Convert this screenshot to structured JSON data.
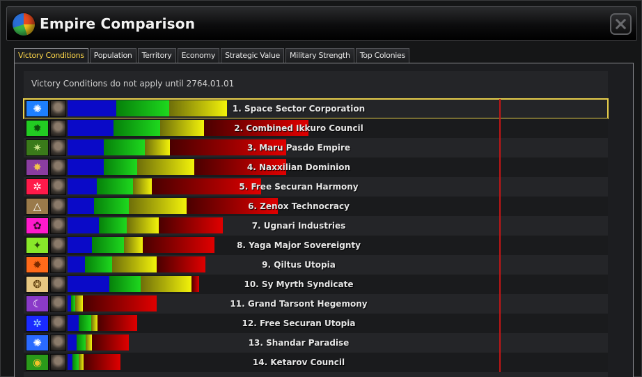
{
  "window": {
    "title": "Empire Comparison"
  },
  "tabs": [
    {
      "label": "Victory Conditions",
      "active": true
    },
    {
      "label": "Population",
      "active": false
    },
    {
      "label": "Territory",
      "active": false
    },
    {
      "label": "Economy",
      "active": false
    },
    {
      "label": "Strategic Value",
      "active": false
    },
    {
      "label": "Military Strength",
      "active": false
    },
    {
      "label": "Top Colonies",
      "active": false
    }
  ],
  "victory": {
    "note": "Victory Conditions do not apply until 2764.01.01",
    "empires": [
      {
        "name": "1. Space Sector Corporation",
        "flag_color": "#1e7fff",
        "flag_glyph": "✺",
        "flag_glyph_color": "#ffffff",
        "segments": [
          70,
          76,
          83,
          0
        ],
        "selected": true
      },
      {
        "name": "2. Combined Ikkuro Council",
        "flag_color": "#22cc22",
        "flag_glyph": "✹",
        "flag_glyph_color": "#0b4d0b",
        "segments": [
          66,
          67,
          63,
          150
        ]
      },
      {
        "name": "3. Maru Pasdo Empire",
        "flag_color": "#3a7a1a",
        "flag_glyph": "✷",
        "flag_glyph_color": "#c9e28a",
        "segments": [
          52,
          59,
          36,
          167
        ]
      },
      {
        "name": "4. Naxxilian Dominion",
        "flag_color": "#8a3da0",
        "flag_glyph": "✸",
        "flag_glyph_color": "#f2c54a",
        "segments": [
          52,
          48,
          82,
          132
        ]
      },
      {
        "name": "5. Free Securan Harmony",
        "flag_color": "#ff1a4a",
        "flag_glyph": "✲",
        "flag_glyph_color": "#ffffff",
        "segments": [
          42,
          52,
          27,
          157
        ]
      },
      {
        "name": "6. Zenox Technocracy",
        "flag_color": "#9a7a4a",
        "flag_glyph": "△",
        "flag_glyph_color": "#ffffff",
        "segments": [
          38,
          50,
          83,
          131
        ]
      },
      {
        "name": "7. Ugnari Industries",
        "flag_color": "#ff1acc",
        "flag_glyph": "✿",
        "flag_glyph_color": "#3a0a2a",
        "segments": [
          45,
          40,
          46,
          92
        ]
      },
      {
        "name": "8. Yaga Major Sovereignty",
        "flag_color": "#88e82a",
        "flag_glyph": "✦",
        "flag_glyph_color": "#2a4a0a",
        "segments": [
          35,
          46,
          27,
          103
        ]
      },
      {
        "name": "9. Qiltus Utopia",
        "flag_color": "#ff6a1a",
        "flag_glyph": "✹",
        "flag_glyph_color": "#7a2a00",
        "segments": [
          25,
          39,
          64,
          70
        ]
      },
      {
        "name": "10. Sy Myrth Syndicate",
        "flag_color": "#e8c882",
        "flag_glyph": "❂",
        "flag_glyph_color": "#5a3a0a",
        "segments": [
          60,
          45,
          73,
          11
        ]
      },
      {
        "name": "11. Grand Tarsont Hegemony",
        "flag_color": "#8a3ac8",
        "flag_glyph": "☾",
        "flag_glyph_color": "#ffffff",
        "segments": [
          5,
          6,
          11,
          106
        ]
      },
      {
        "name": "12. Free Securan Utopia",
        "flag_color": "#1a2aff",
        "flag_glyph": "✲",
        "flag_glyph_color": "#9ad0ff",
        "segments": [
          16,
          18,
          9,
          57
        ]
      },
      {
        "name": "13. Shandar Paradise",
        "flag_color": "#2a6aff",
        "flag_glyph": "✺",
        "flag_glyph_color": "#ffffff",
        "segments": [
          13,
          13,
          9,
          53
        ]
      },
      {
        "name": "14. Ketarov Council",
        "flag_color": "#2a9a1a",
        "flag_glyph": "◉",
        "flag_glyph_color": "#f2c22a",
        "segments": [
          7,
          9,
          7,
          53
        ]
      }
    ]
  }
}
